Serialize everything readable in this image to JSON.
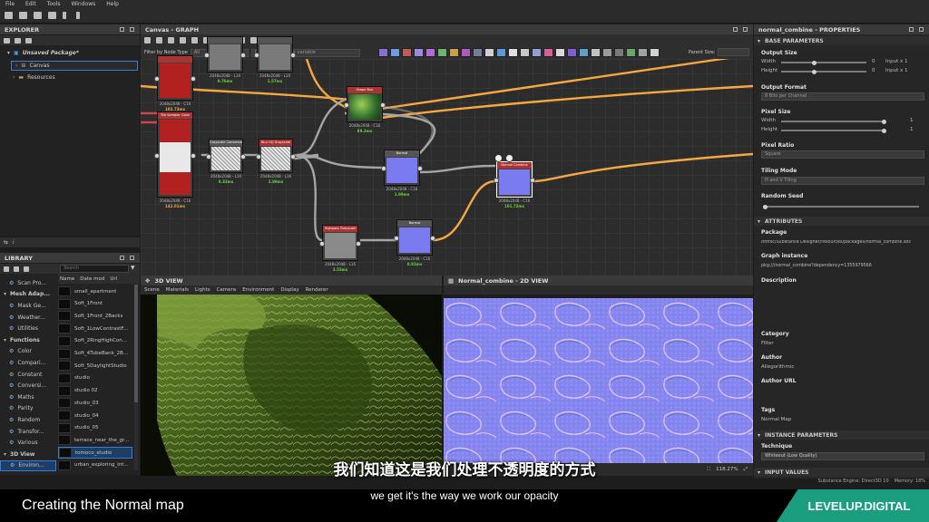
{
  "menu": [
    "File",
    "Edit",
    "Tools",
    "Windows",
    "Help"
  ],
  "explorer": {
    "title": "EXPLORER",
    "package": "Unsaved Package*",
    "items": [
      "Canvas",
      "Resources"
    ]
  },
  "graph": {
    "title": "Canvas - GRAPH",
    "filter_label": "Filter by Node Type",
    "filter_value": "All",
    "search_placeholder": "Containing text or variable",
    "parent_size_label": "Parent Size:",
    "nodes": [
      {
        "title": "",
        "label": "2048x2048 - C16",
        "time": "102.73ms",
        "kind": "red"
      },
      {
        "title": "",
        "label": "2048x2048 - L16",
        "time": "0.76ms",
        "kind": "gray"
      },
      {
        "title": "",
        "label": "2048x2048 - L16",
        "time": "1.57ms",
        "kind": "gray"
      },
      {
        "title": "Tile Sampler Color",
        "label": "2048x2048 - C16",
        "time": "142.01ms",
        "kind": "redwhite"
      },
      {
        "title": "Grayscale Conversion",
        "label": "2048x2048 - L16",
        "time": "0.33ms",
        "kind": "noise"
      },
      {
        "title": "Blur HQ Grayscale",
        "label": "2048x2048 - L16",
        "time": "2.89ms",
        "kind": "noise"
      },
      {
        "title": "Shape Blur",
        "label": "2048x2048 - C16",
        "time": "89.2ms",
        "kind": "green"
      },
      {
        "title": "Normal",
        "label": "2048x2048 - C16",
        "time": "1.99ms",
        "kind": "blue"
      },
      {
        "title": "Normal Combine",
        "label": "2048x2048 - C16",
        "time": "101.72ms",
        "kind": "blue"
      },
      {
        "title": "Highpass Grayscale",
        "label": "2048x2048 - L16",
        "time": "3.53ms",
        "kind": "grayflat"
      },
      {
        "title": "Normal",
        "label": "2048x2048 - C16",
        "time": "0.91ms",
        "kind": "blue"
      }
    ]
  },
  "properties": {
    "title": "normal_combine - PROPERTIES",
    "base_header": "BASE PARAMETERS",
    "output_size": "Output Size",
    "width": "Width",
    "height": "Height",
    "zero": "0",
    "input_x1": "Input x 1",
    "output_format": "Output Format",
    "output_format_value": "8 Bits per Channel",
    "pixel_size": "Pixel Size",
    "one": "1",
    "pixel_ratio": "Pixel Ratio",
    "pixel_ratio_value": "Square",
    "tiling_mode": "Tiling Mode",
    "tiling_mode_value": "H and V Tiling",
    "random_seed": "Random Seed",
    "attr_header": "ATTRIBUTES",
    "package": "Package",
    "package_value": "ithmic/Substance Designer/resources/packages/normal_combine.sbs",
    "graph_instance": "Graph instance",
    "graph_instance_value": "pkg:///normal_combine?dependency=1355979566",
    "description": "Description",
    "category": "Category",
    "category_value": "Filter",
    "author": "Author",
    "author_value": "Allegorithmic",
    "author_url": "Author URL",
    "tags": "Tags",
    "tags_value": "Normal Map",
    "inst_header": "INSTANCE PARAMETERS",
    "technique": "Technique",
    "technique_value": "Whiteout (Low Quality)",
    "input_header": "INPUT VALUES"
  },
  "library": {
    "title": "LIBRARY",
    "search_placeholder": "Search",
    "col_name": "Name",
    "col_date": "Date mod",
    "col_url": "Url",
    "categories": [
      "Scan Pro...",
      "Mesh Adap...",
      "Mask Ge...",
      "Weather...",
      "Utilities",
      "Functions",
      "Color",
      "Compari...",
      "Constant",
      "Conversi...",
      "Maths",
      "Parity",
      "Random",
      "Transfor...",
      "Various",
      "3D View",
      "Environ..."
    ],
    "materials": [
      "small_apartment",
      "Soft_1Front",
      "Soft_1Front_2Backs",
      "Soft_1LowContrastF...",
      "Soft_2RingHighCon...",
      "Soft_4TubeBank_2B...",
      "Soft_5DaylightStudio",
      "studio",
      "studio 02",
      "studio_03",
      "studio_04",
      "studio_05",
      "terrace_near_the_gr...",
      "tomoco_studio",
      "urban_exploring_int..."
    ]
  },
  "view3d": {
    "title": "3D VIEW",
    "menu": [
      "Scene",
      "Materials",
      "Lights",
      "Camera",
      "Environment",
      "Display",
      "Renderer"
    ]
  },
  "view2d": {
    "title": "Normal_combine - 2D VIEW",
    "zoom": "118.27%"
  },
  "status": {
    "engine": "Substance Engine: Direct3D 10",
    "memory": "Memory: 18%"
  },
  "captions": {
    "title": "Creating the Normal map",
    "chinese": "我们知道这是我们处理不透明度的方式",
    "english": "we get it's the way we work our opacity",
    "brand": "LEVELUP.DIGITAL"
  },
  "colors": {
    "accent": "#f5a742",
    "brand": "#1a9e7f",
    "node_time": "#68d63b"
  }
}
